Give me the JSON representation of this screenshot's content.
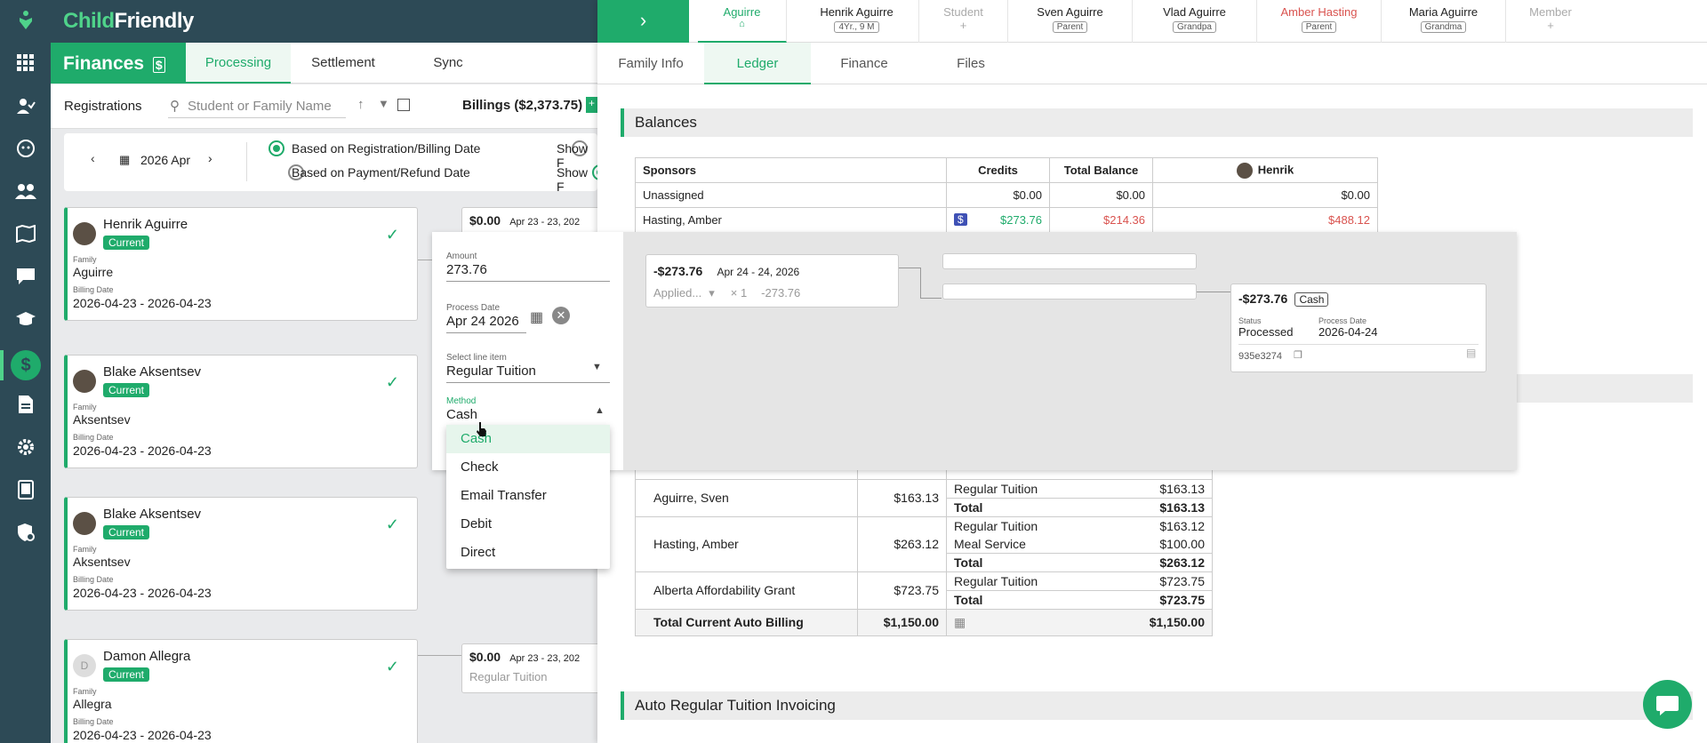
{
  "app": {
    "brand_part1": "Child",
    "brand_part2": "Friendly"
  },
  "finances": {
    "title": "Finances",
    "tabs": [
      "Processing",
      "Settlement",
      "Sync"
    ]
  },
  "registrations": {
    "label": "Registrations",
    "search_placeholder": "Student or Family Name",
    "billings": "Billings ($2,373.75)"
  },
  "filters": {
    "month": "2026 Apr",
    "radio1": "Based on Registration/Billing Date",
    "radio2": "Based on Payment/Refund Date",
    "show1": "Show F",
    "show2": "Show F"
  },
  "labels": {
    "family": "Family",
    "billing_date": "Billing Date"
  },
  "cards": [
    {
      "name": "Henrik Aguirre",
      "badge": "Current",
      "family": "Aguirre",
      "dates": "2026-04-23 - 2026-04-23"
    },
    {
      "name": "Blake Aksentsev",
      "badge": "Current",
      "family": "Aksentsev",
      "dates": "2026-04-23 - 2026-04-23"
    },
    {
      "name": "Blake Aksentsev",
      "badge": "Current",
      "family": "Aksentsev",
      "dates": "2026-04-23 - 2026-04-23"
    },
    {
      "name": "Damon Allegra",
      "badge": "Current",
      "family": "Allegra",
      "dates": "2026-04-23 - 2026-04-23",
      "initial": "D"
    }
  ],
  "mini_pay": [
    {
      "amount": "$0.00",
      "range": "Apr 23 - 23, 202"
    },
    {
      "amount": "$0.00",
      "range": "Apr 23 - 23, 202",
      "item": "Regular Tuition"
    }
  ],
  "members": [
    {
      "name": "Aguirre",
      "sub": "⌂"
    },
    {
      "name": "Henrik Aguirre",
      "role": "4Yr., 9 M"
    },
    {
      "name": "Student",
      "sub": "+"
    },
    {
      "name": "Sven Aguirre",
      "role": "Parent"
    },
    {
      "name": "Vlad Aguirre",
      "role": "Grandpa"
    },
    {
      "name": "Amber Hasting",
      "role": "Parent"
    },
    {
      "name": "Maria Aguirre",
      "role": "Grandma"
    },
    {
      "name": "Member",
      "sub": "+"
    }
  ],
  "sub_tabs": [
    "Family Info",
    "Ledger",
    "Finance",
    "Files"
  ],
  "balances": {
    "title": "Balances",
    "headers": [
      "Sponsors",
      "Credits",
      "Total Balance",
      "Henrik"
    ],
    "rows": [
      {
        "sponsor": "Unassigned",
        "credits": "$0.00",
        "total": "$0.00",
        "henrik": "$0.00"
      },
      {
        "sponsor": "Hasting, Amber",
        "credits": "$273.76",
        "total": "$214.36",
        "henrik": "$488.12"
      }
    ]
  },
  "grants": {
    "rows": [
      {
        "name": "Aguirre, Sven",
        "amount": "$163.13",
        "lines": [
          {
            "k": "Regular Tuition",
            "v": "$163.13"
          },
          {
            "k": "Total",
            "v": "$163.13"
          }
        ]
      },
      {
        "name": "Hasting, Amber",
        "amount": "$263.12",
        "lines": [
          {
            "k": "Regular Tuition",
            "v": "$163.12"
          },
          {
            "k": "Meal Service",
            "v": "$100.00"
          },
          {
            "k": "Total",
            "v": "$263.12"
          }
        ]
      },
      {
        "name": "Alberta Affordability Grant",
        "amount": "$723.75",
        "lines": [
          {
            "k": "Regular Tuition",
            "v": "$723.75"
          },
          {
            "k": "Total",
            "v": "$723.75"
          }
        ]
      }
    ],
    "total_label": "Total Current Auto Billing",
    "total_amount": "$1,150.00",
    "total_right": "$1,150.00"
  },
  "auto_section": "Auto Regular Tuition Invoicing",
  "pay_form": {
    "amount_label": "Amount",
    "amount_value": "273.76",
    "date_label": "Process Date",
    "date_value": "Apr 24 2026",
    "line_label": "Select line item",
    "line_value": "Regular Tuition",
    "method_label": "Method",
    "method_value": "Cash"
  },
  "method_options": [
    "Cash",
    "Check",
    "Email Transfer",
    "Debit",
    "Direct"
  ],
  "ledger_entry": {
    "amount": "-$273.76",
    "range": "Apr 24 - 24, 2026",
    "applied": "Applied...",
    "qty": "× 1",
    "value": "-273.76"
  },
  "payment_card": {
    "amount": "-$273.76",
    "method": "Cash",
    "status_label": "Status",
    "status": "Processed",
    "date_label": "Process Date",
    "date": "2026-04-24",
    "id": "935e3274"
  },
  "colors": {
    "accent": "#1fab6b",
    "rail": "#2d4a56",
    "negative": "#d9534f"
  }
}
